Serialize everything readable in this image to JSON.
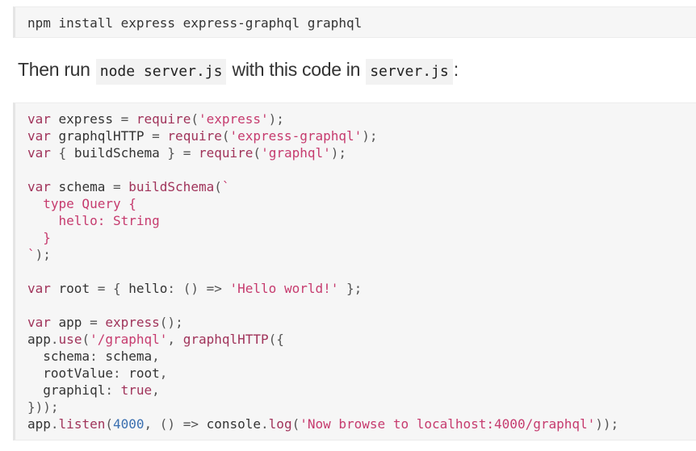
{
  "install_block": {
    "command": "npm install express express-graphql graphql"
  },
  "instruction": {
    "before": "Then run ",
    "code1": "node server.js",
    "middle": " with this code in ",
    "code2": "server.js",
    "after": ":"
  },
  "code_block": {
    "lines": [
      {
        "tokens": [
          {
            "t": "kw",
            "v": "var"
          },
          {
            "t": "plain",
            "v": " express "
          },
          {
            "t": "punc",
            "v": "="
          },
          {
            "t": "plain",
            "v": " "
          },
          {
            "t": "kw",
            "v": "require"
          },
          {
            "t": "punc",
            "v": "("
          },
          {
            "t": "str",
            "v": "'express'"
          },
          {
            "t": "punc",
            "v": ");"
          }
        ]
      },
      {
        "tokens": [
          {
            "t": "kw",
            "v": "var"
          },
          {
            "t": "plain",
            "v": " graphqlHTTP "
          },
          {
            "t": "punc",
            "v": "="
          },
          {
            "t": "plain",
            "v": " "
          },
          {
            "t": "kw",
            "v": "require"
          },
          {
            "t": "punc",
            "v": "("
          },
          {
            "t": "str",
            "v": "'express-graphql'"
          },
          {
            "t": "punc",
            "v": ");"
          }
        ]
      },
      {
        "tokens": [
          {
            "t": "kw",
            "v": "var"
          },
          {
            "t": "plain",
            "v": " "
          },
          {
            "t": "punc",
            "v": "{"
          },
          {
            "t": "plain",
            "v": " buildSchema "
          },
          {
            "t": "punc",
            "v": "}"
          },
          {
            "t": "plain",
            "v": " "
          },
          {
            "t": "punc",
            "v": "="
          },
          {
            "t": "plain",
            "v": " "
          },
          {
            "t": "kw",
            "v": "require"
          },
          {
            "t": "punc",
            "v": "("
          },
          {
            "t": "str",
            "v": "'graphql'"
          },
          {
            "t": "punc",
            "v": ");"
          }
        ]
      },
      {
        "tokens": []
      },
      {
        "tokens": [
          {
            "t": "kw",
            "v": "var"
          },
          {
            "t": "plain",
            "v": " schema "
          },
          {
            "t": "punc",
            "v": "="
          },
          {
            "t": "plain",
            "v": " "
          },
          {
            "t": "kw",
            "v": "buildSchema"
          },
          {
            "t": "punc",
            "v": "("
          },
          {
            "t": "str",
            "v": "`"
          }
        ]
      },
      {
        "tokens": [
          {
            "t": "str",
            "v": "  type Query {"
          }
        ]
      },
      {
        "tokens": [
          {
            "t": "str",
            "v": "    hello: String"
          }
        ]
      },
      {
        "tokens": [
          {
            "t": "str",
            "v": "  }"
          }
        ]
      },
      {
        "tokens": [
          {
            "t": "str",
            "v": "`"
          },
          {
            "t": "punc",
            "v": ");"
          }
        ]
      },
      {
        "tokens": []
      },
      {
        "tokens": [
          {
            "t": "kw",
            "v": "var"
          },
          {
            "t": "plain",
            "v": " root "
          },
          {
            "t": "punc",
            "v": "="
          },
          {
            "t": "plain",
            "v": " "
          },
          {
            "t": "punc",
            "v": "{"
          },
          {
            "t": "plain",
            "v": " hello"
          },
          {
            "t": "punc",
            "v": ":"
          },
          {
            "t": "plain",
            "v": " "
          },
          {
            "t": "punc",
            "v": "()"
          },
          {
            "t": "plain",
            "v": " "
          },
          {
            "t": "punc",
            "v": "=>"
          },
          {
            "t": "plain",
            "v": " "
          },
          {
            "t": "str",
            "v": "'Hello world!'"
          },
          {
            "t": "plain",
            "v": " "
          },
          {
            "t": "punc",
            "v": "};"
          }
        ]
      },
      {
        "tokens": []
      },
      {
        "tokens": [
          {
            "t": "kw",
            "v": "var"
          },
          {
            "t": "plain",
            "v": " app "
          },
          {
            "t": "punc",
            "v": "="
          },
          {
            "t": "plain",
            "v": " "
          },
          {
            "t": "kw",
            "v": "express"
          },
          {
            "t": "punc",
            "v": "();"
          }
        ]
      },
      {
        "tokens": [
          {
            "t": "plain",
            "v": "app"
          },
          {
            "t": "punc",
            "v": "."
          },
          {
            "t": "kw",
            "v": "use"
          },
          {
            "t": "punc",
            "v": "("
          },
          {
            "t": "str",
            "v": "'/graphql'"
          },
          {
            "t": "punc",
            "v": ","
          },
          {
            "t": "plain",
            "v": " "
          },
          {
            "t": "kw",
            "v": "graphqlHTTP"
          },
          {
            "t": "punc",
            "v": "({"
          }
        ]
      },
      {
        "tokens": [
          {
            "t": "plain",
            "v": "  schema"
          },
          {
            "t": "punc",
            "v": ":"
          },
          {
            "t": "plain",
            "v": " schema"
          },
          {
            "t": "punc",
            "v": ","
          }
        ]
      },
      {
        "tokens": [
          {
            "t": "plain",
            "v": "  rootValue"
          },
          {
            "t": "punc",
            "v": ":"
          },
          {
            "t": "plain",
            "v": " root"
          },
          {
            "t": "punc",
            "v": ","
          }
        ]
      },
      {
        "tokens": [
          {
            "t": "plain",
            "v": "  graphiql"
          },
          {
            "t": "punc",
            "v": ":"
          },
          {
            "t": "plain",
            "v": " "
          },
          {
            "t": "kw",
            "v": "true"
          },
          {
            "t": "punc",
            "v": ","
          }
        ]
      },
      {
        "tokens": [
          {
            "t": "punc",
            "v": "}));"
          }
        ]
      },
      {
        "tokens": [
          {
            "t": "plain",
            "v": "app"
          },
          {
            "t": "punc",
            "v": "."
          },
          {
            "t": "kw",
            "v": "listen"
          },
          {
            "t": "punc",
            "v": "("
          },
          {
            "t": "num",
            "v": "4000"
          },
          {
            "t": "punc",
            "v": ","
          },
          {
            "t": "plain",
            "v": " "
          },
          {
            "t": "punc",
            "v": "()"
          },
          {
            "t": "plain",
            "v": " "
          },
          {
            "t": "punc",
            "v": "=>"
          },
          {
            "t": "plain",
            "v": " console"
          },
          {
            "t": "punc",
            "v": "."
          },
          {
            "t": "kw",
            "v": "log"
          },
          {
            "t": "punc",
            "v": "("
          },
          {
            "t": "str",
            "v": "'Now browse to localhost:4000/graphql'"
          },
          {
            "t": "punc",
            "v": "));"
          }
        ]
      }
    ]
  },
  "colors": {
    "keyword": "#a0335a",
    "string": "#c63b6e",
    "number": "#3a6fb0",
    "code_background": "#f6f6f6"
  }
}
